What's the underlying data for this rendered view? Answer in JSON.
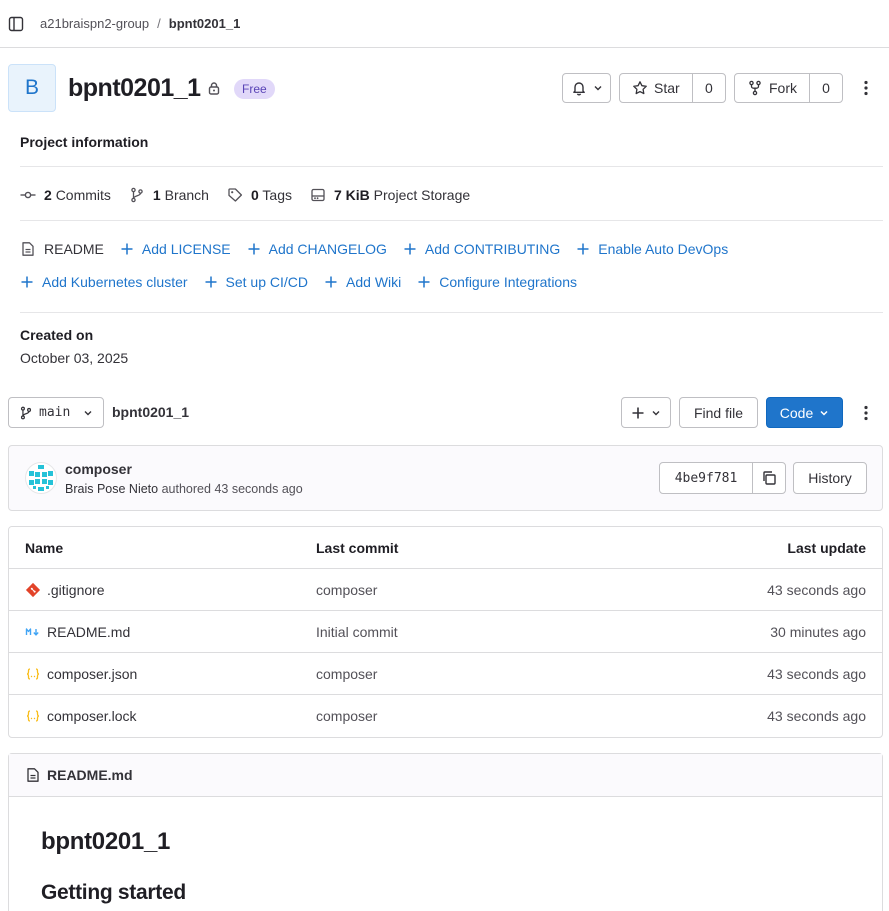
{
  "breadcrumb": {
    "group": "a21braispn2-group",
    "separator": "/",
    "project": "bpnt0201_1"
  },
  "project": {
    "avatar_letter": "B",
    "name": "bpnt0201_1",
    "badge": "Free"
  },
  "actions": {
    "star_label": "Star",
    "star_count": "0",
    "fork_label": "Fork",
    "fork_count": "0"
  },
  "project_info": {
    "title": "Project information",
    "stats": [
      {
        "value": "2",
        "label": "Commits",
        "icon": "commit-icon"
      },
      {
        "value": "1",
        "label": "Branch",
        "icon": "branch-icon"
      },
      {
        "value": "0",
        "label": "Tags",
        "icon": "tag-icon"
      },
      {
        "value": "7 KiB",
        "label": "Project Storage",
        "icon": "storage-icon"
      }
    ],
    "links_row1": [
      "README",
      "Add LICENSE",
      "Add CHANGELOG",
      "Add CONTRIBUTING",
      "Enable Auto DevOps"
    ],
    "links_row2": [
      "Add Kubernetes cluster",
      "Set up CI/CD",
      "Add Wiki",
      "Configure Integrations"
    ],
    "created_label": "Created on",
    "created_date": "October 03, 2025"
  },
  "repo": {
    "branch": "main",
    "path": "bpnt0201_1",
    "find_file": "Find file",
    "code": "Code"
  },
  "last_commit": {
    "title": "composer",
    "author": "Brais Pose Nieto",
    "action": "authored",
    "time": "43 seconds ago",
    "sha": "4be9f781",
    "history": "History"
  },
  "file_table": {
    "headers": [
      "Name",
      "Last commit",
      "Last update"
    ],
    "rows": [
      {
        "name": ".gitignore",
        "commit": "composer",
        "updated": "43 seconds ago",
        "icon": "git-file-icon"
      },
      {
        "name": "README.md",
        "commit": "Initial commit",
        "updated": "30 minutes ago",
        "icon": "markdown-icon"
      },
      {
        "name": "composer.json",
        "commit": "composer",
        "updated": "43 seconds ago",
        "icon": "json-icon"
      },
      {
        "name": "composer.lock",
        "commit": "composer",
        "updated": "43 seconds ago",
        "icon": "json-icon"
      }
    ]
  },
  "readme": {
    "filename": "README.md",
    "h1": "bpnt0201_1",
    "h2": "Getting started"
  },
  "colors": {
    "link": "#1f75cb",
    "primary_button": "#1f75cb",
    "badge_bg": "#e1d8f9",
    "badge_text": "#5943b6"
  }
}
